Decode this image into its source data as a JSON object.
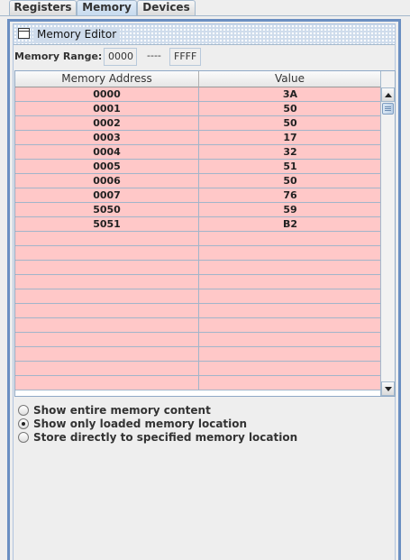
{
  "tabs": [
    {
      "label": "Registers",
      "active": false
    },
    {
      "label": "Memory",
      "active": true
    },
    {
      "label": "Devices",
      "active": false
    }
  ],
  "editor": {
    "title": "Memory Editor",
    "title_icon": "window-icon"
  },
  "range": {
    "label": "Memory Range:",
    "start": "0000",
    "separator": "----",
    "end": "FFFF"
  },
  "table": {
    "columns": [
      "Memory Address",
      "Value"
    ],
    "rows": [
      {
        "address": "0000",
        "value": "3A"
      },
      {
        "address": "0001",
        "value": "50"
      },
      {
        "address": "0002",
        "value": "50"
      },
      {
        "address": "0003",
        "value": "17"
      },
      {
        "address": "0004",
        "value": "32"
      },
      {
        "address": "0005",
        "value": "51"
      },
      {
        "address": "0006",
        "value": "50"
      },
      {
        "address": "0007",
        "value": "76"
      },
      {
        "address": "5050",
        "value": "59"
      },
      {
        "address": "5051",
        "value": "B2"
      },
      {
        "address": "",
        "value": ""
      },
      {
        "address": "",
        "value": ""
      },
      {
        "address": "",
        "value": ""
      },
      {
        "address": "",
        "value": ""
      },
      {
        "address": "",
        "value": ""
      },
      {
        "address": "",
        "value": ""
      },
      {
        "address": "",
        "value": ""
      },
      {
        "address": "",
        "value": ""
      },
      {
        "address": "",
        "value": ""
      },
      {
        "address": "",
        "value": ""
      },
      {
        "address": "",
        "value": ""
      }
    ],
    "row_color": "#ffc8c8"
  },
  "options": [
    {
      "label": "Show entire memory content",
      "selected": false
    },
    {
      "label": "Show only loaded memory location",
      "selected": true
    },
    {
      "label": "Store directly to specified memory location",
      "selected": false
    }
  ],
  "colors": {
    "frame_border": "#6b8fc2",
    "row_background": "#ffc8c8",
    "background": "#eeeeee"
  }
}
